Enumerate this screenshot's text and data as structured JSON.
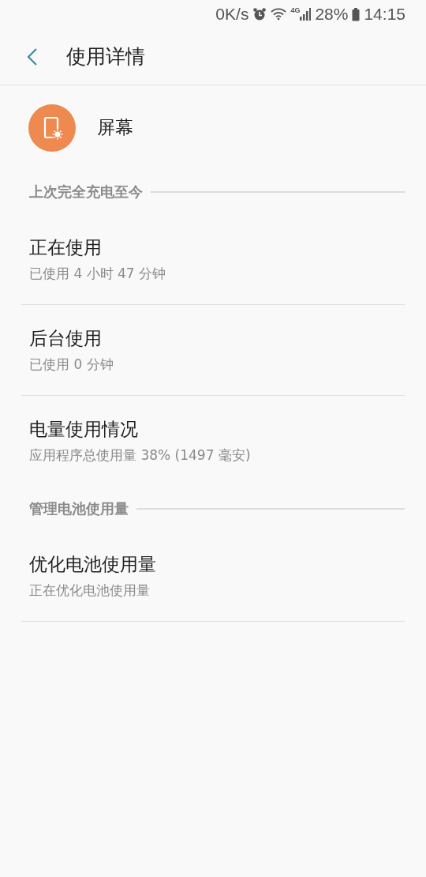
{
  "status_bar": {
    "speed": "0K/s",
    "network": "4G",
    "battery": "28%",
    "time": "14:15"
  },
  "header": {
    "title": "使用详情"
  },
  "app": {
    "name": "屏幕"
  },
  "sections": [
    {
      "title": "上次完全充电至今",
      "items": [
        {
          "title": "正在使用",
          "subtitle": "已使用 4 小时 47 分钟",
          "divider": true
        },
        {
          "title": "后台使用",
          "subtitle": "已使用 0 分钟",
          "divider": true
        },
        {
          "title": "电量使用情况",
          "subtitle": "应用程序总使用量 38% (1497 毫安)",
          "divider": false
        }
      ]
    },
    {
      "title": "管理电池使用量",
      "items": [
        {
          "title": "优化电池使用量",
          "subtitle": "正在优化电池使用量",
          "divider": true
        }
      ]
    }
  ]
}
